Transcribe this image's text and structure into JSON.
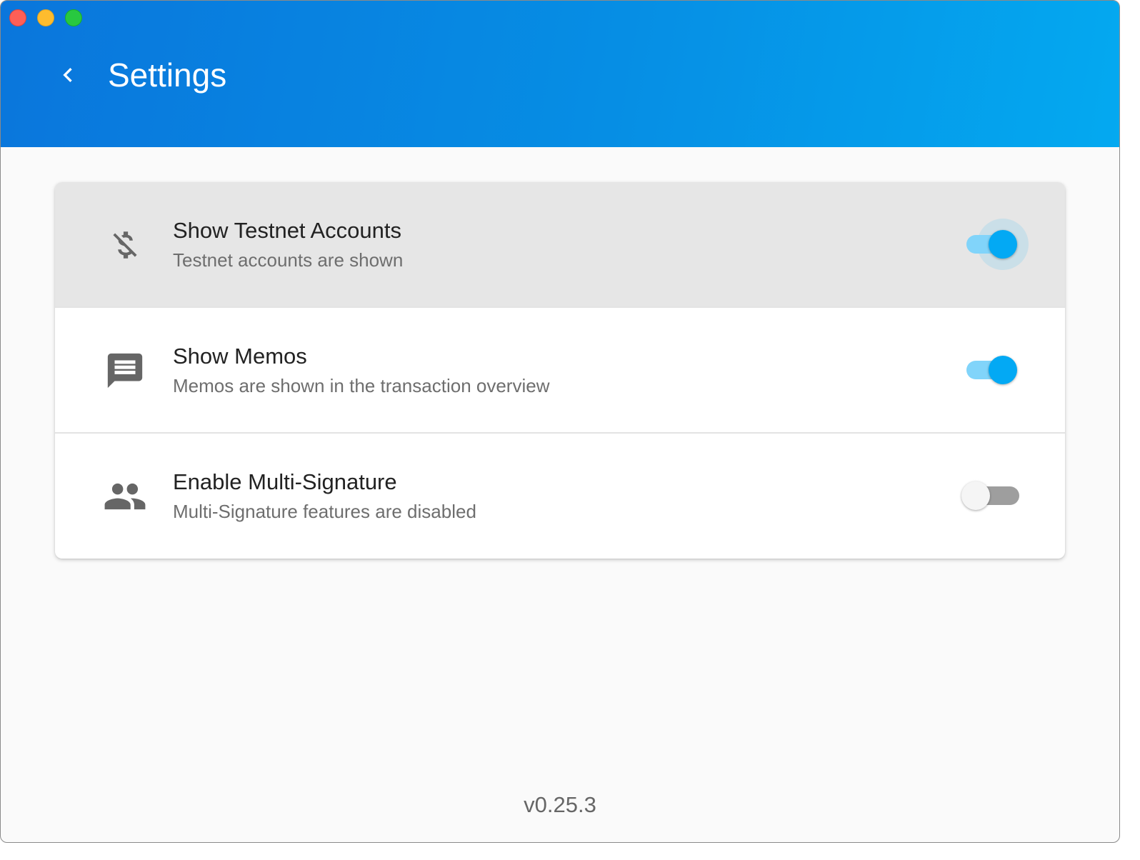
{
  "window": {
    "controls": [
      "close",
      "minimize",
      "maximize"
    ]
  },
  "header": {
    "title": "Settings",
    "back_icon": "chevron-left-icon",
    "gradient": [
      "#0a76dc",
      "#04a9f0"
    ]
  },
  "settings": {
    "items": [
      {
        "title": "Show Testnet Accounts",
        "subtitle": "Testnet accounts are shown",
        "icon": "money-off-icon",
        "enabled": true,
        "hovered": true
      },
      {
        "title": "Show Memos",
        "subtitle": "Memos are shown in the transaction overview",
        "icon": "message-icon",
        "enabled": true,
        "hovered": false
      },
      {
        "title": "Enable Multi-Signature",
        "subtitle": "Multi-Signature features are disabled",
        "icon": "people-icon",
        "enabled": false,
        "hovered": false
      }
    ]
  },
  "footer": {
    "version": "v0.25.3"
  },
  "colors": {
    "accent": "#03a9f4",
    "accent_light": "#81d4fa",
    "icon": "#666666"
  }
}
